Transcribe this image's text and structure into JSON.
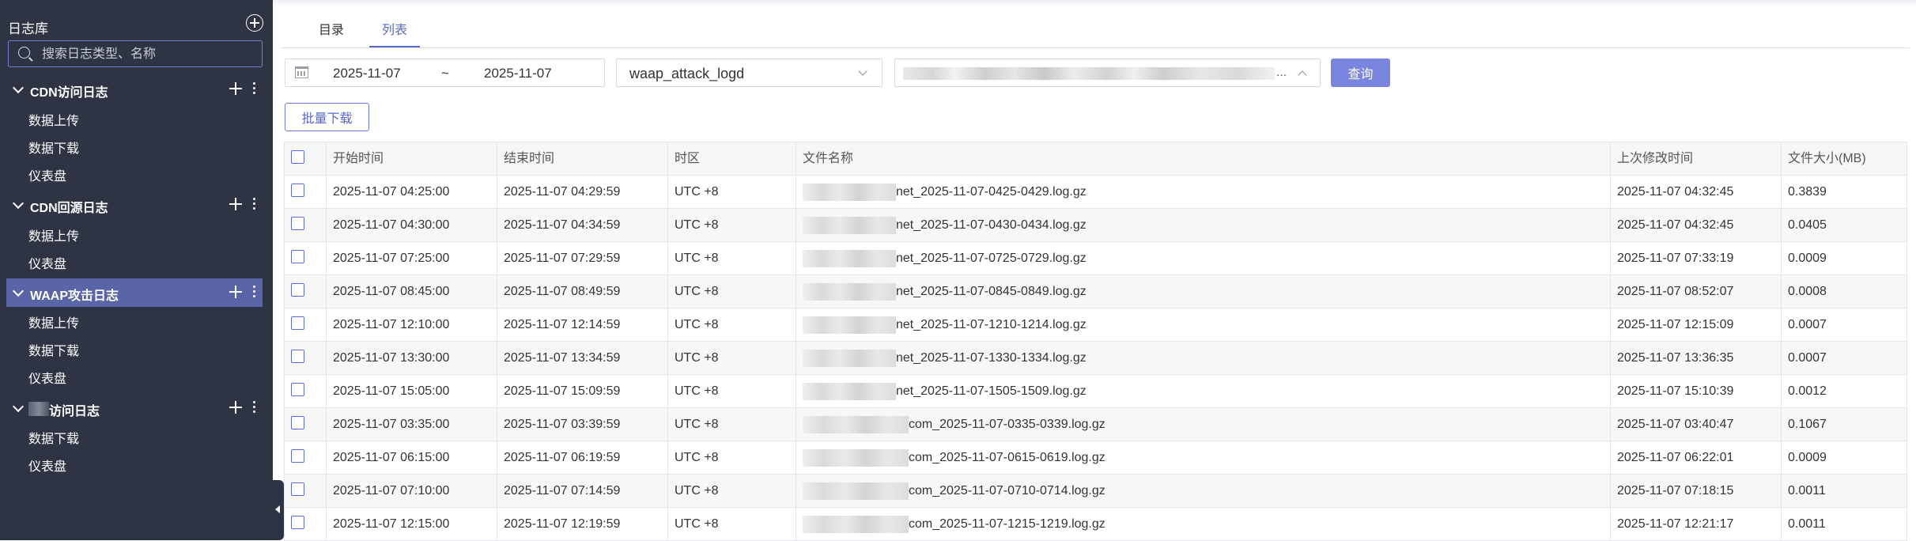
{
  "sidebar": {
    "title": "日志库",
    "search_placeholder": "搜索日志类型、名称",
    "groups": [
      {
        "label": "CDN访问日志",
        "items": [
          "数据上传",
          "数据下载",
          "仪表盘"
        ]
      },
      {
        "label": "CDN回源日志",
        "items": [
          "数据上传",
          "仪表盘"
        ]
      },
      {
        "label": "WAAP攻击日志",
        "items": [
          "数据上传",
          "数据下载",
          "仪表盘"
        ],
        "active": true
      },
      {
        "label": "访问日志",
        "items": [
          "数据下载",
          "仪表盘"
        ]
      }
    ]
  },
  "tabs": [
    "目录",
    "列表"
  ],
  "active_tab": "列表",
  "filters": {
    "date_start": "2025-11-07",
    "date_sep": "~",
    "date_end": "2025-11-07",
    "log_type": "waap_attack_logd",
    "domain_ellipsis": "...",
    "query_label": "查询"
  },
  "batch_download_label": "批量下载",
  "table": {
    "headers": [
      "开始时间",
      "结束时间",
      "时区",
      "文件名称",
      "上次修改时间",
      "文件大小(MB)"
    ],
    "rows": [
      {
        "start": "2025-11-07 04:25:00",
        "end": "2025-11-07 04:29:59",
        "tz": "UTC +8",
        "file": "net_2025-11-07-0425-0429.log.gz",
        "modified": "2025-11-07 04:32:45",
        "size": "0.3839"
      },
      {
        "start": "2025-11-07 04:30:00",
        "end": "2025-11-07 04:34:59",
        "tz": "UTC +8",
        "file": "net_2025-11-07-0430-0434.log.gz",
        "modified": "2025-11-07 04:32:45",
        "size": "0.0405"
      },
      {
        "start": "2025-11-07 07:25:00",
        "end": "2025-11-07 07:29:59",
        "tz": "UTC +8",
        "file": "net_2025-11-07-0725-0729.log.gz",
        "modified": "2025-11-07 07:33:19",
        "size": "0.0009"
      },
      {
        "start": "2025-11-07 08:45:00",
        "end": "2025-11-07 08:49:59",
        "tz": "UTC +8",
        "file": "net_2025-11-07-0845-0849.log.gz",
        "modified": "2025-11-07 08:52:07",
        "size": "0.0008"
      },
      {
        "start": "2025-11-07 12:10:00",
        "end": "2025-11-07 12:14:59",
        "tz": "UTC +8",
        "file": "net_2025-11-07-1210-1214.log.gz",
        "modified": "2025-11-07 12:15:09",
        "size": "0.0007"
      },
      {
        "start": "2025-11-07 13:30:00",
        "end": "2025-11-07 13:34:59",
        "tz": "UTC +8",
        "file": "net_2025-11-07-1330-1334.log.gz",
        "modified": "2025-11-07 13:36:35",
        "size": "0.0007"
      },
      {
        "start": "2025-11-07 15:05:00",
        "end": "2025-11-07 15:09:59",
        "tz": "UTC +8",
        "file": "net_2025-11-07-1505-1509.log.gz",
        "modified": "2025-11-07 15:10:39",
        "size": "0.0012"
      },
      {
        "start": "2025-11-07 03:35:00",
        "end": "2025-11-07 03:39:59",
        "tz": "UTC +8",
        "file": "com_2025-11-07-0335-0339.log.gz",
        "modified": "2025-11-07 03:40:47",
        "size": "0.1067"
      },
      {
        "start": "2025-11-07 06:15:00",
        "end": "2025-11-07 06:19:59",
        "tz": "UTC +8",
        "file": "com_2025-11-07-0615-0619.log.gz",
        "modified": "2025-11-07 06:22:01",
        "size": "0.0009"
      },
      {
        "start": "2025-11-07 07:10:00",
        "end": "2025-11-07 07:14:59",
        "tz": "UTC +8",
        "file": "com_2025-11-07-0710-0714.log.gz",
        "modified": "2025-11-07 07:18:15",
        "size": "0.0011"
      },
      {
        "start": "2025-11-07 12:15:00",
        "end": "2025-11-07 12:19:59",
        "tz": "UTC +8",
        "file": "com_2025-11-07-1215-1219.log.gz",
        "modified": "2025-11-07 12:21:17",
        "size": "0.0011"
      }
    ]
  },
  "colors": {
    "sidebar_bg": "#2e3444",
    "active_group": "#5965a6",
    "accent": "#5968c9",
    "query_button": "#7a85e0"
  },
  "icons": [
    "add-circle-icon",
    "search-icon",
    "chevron-down-icon",
    "plus-icon",
    "more-vertical-icon",
    "calendar-icon",
    "chevron-up-icon",
    "collapse-left-icon"
  ]
}
